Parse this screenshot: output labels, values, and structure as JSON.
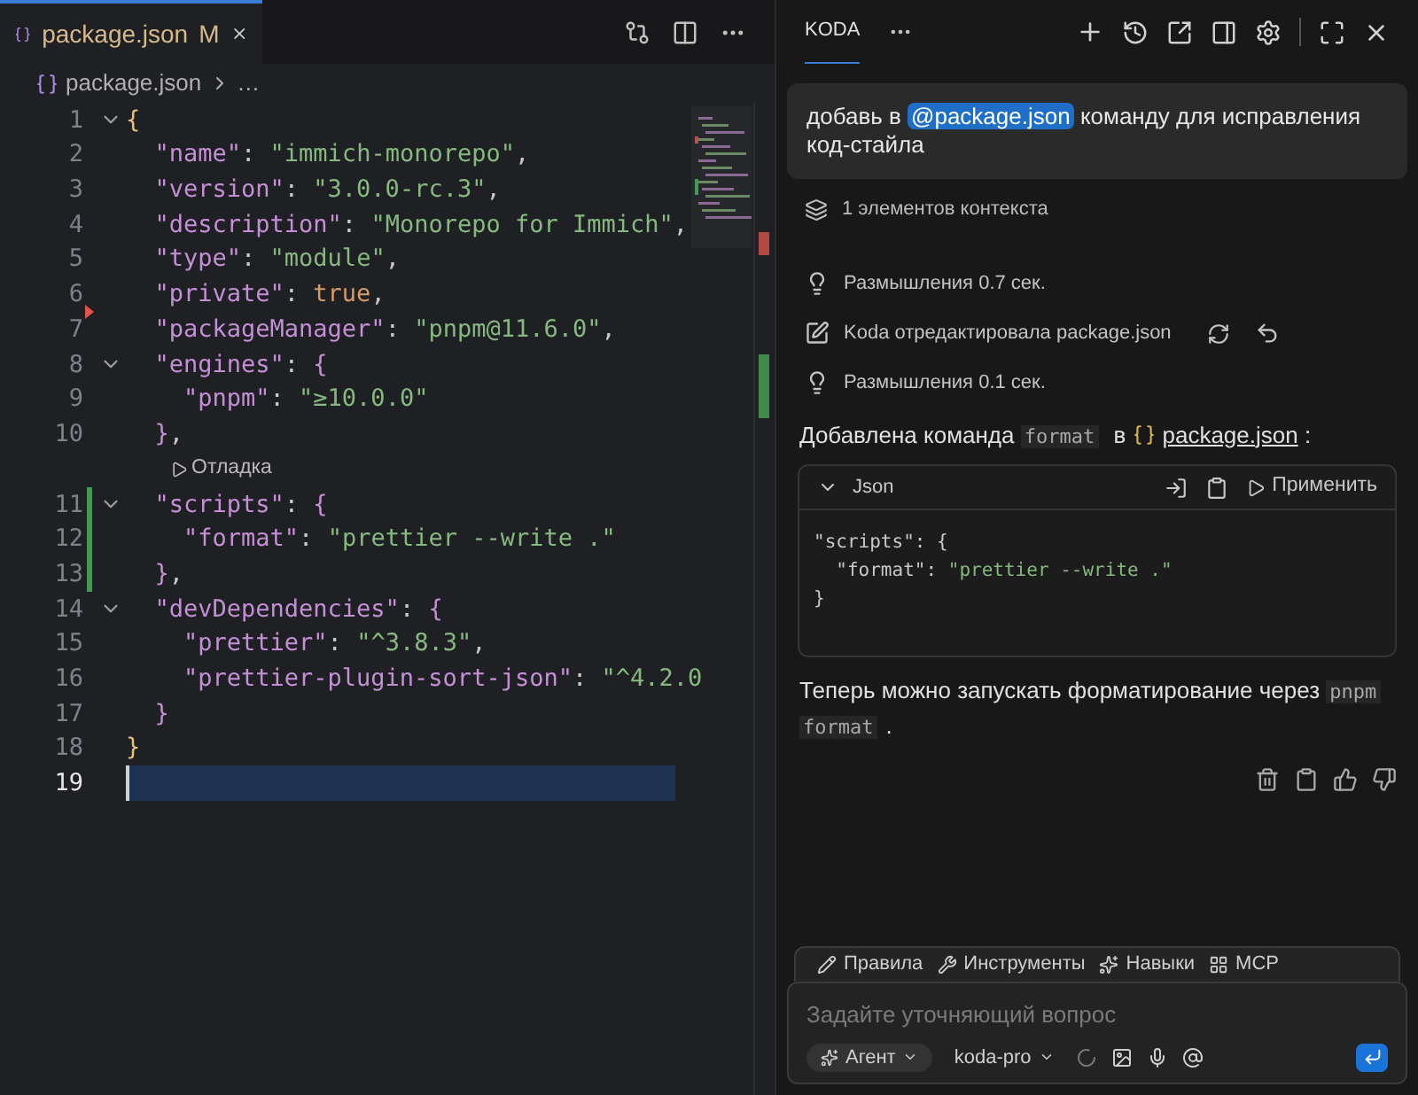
{
  "editor": {
    "tab": {
      "title": "package.json",
      "badge": "M"
    },
    "breadcrumb": {
      "file": "package.json",
      "rest": "…"
    },
    "lines": [
      {
        "kind": "code",
        "number": "1",
        "foldable": true,
        "selected": false,
        "tokens": [
          {
            "kind": "brace0",
            "text": "{"
          }
        ]
      },
      {
        "kind": "code",
        "number": "2",
        "selected": false,
        "tokens": [
          {
            "kind": "key",
            "text": "  \"name\""
          },
          {
            "kind": "punct",
            "text": ": "
          },
          {
            "kind": "str",
            "text": "\"immich-monorepo\""
          },
          {
            "kind": "punct",
            "text": ","
          }
        ]
      },
      {
        "kind": "code",
        "number": "3",
        "selected": false,
        "tokens": [
          {
            "kind": "key",
            "text": "  \"version\""
          },
          {
            "kind": "punct",
            "text": ": "
          },
          {
            "kind": "str",
            "text": "\"3.0.0-rc.3\""
          },
          {
            "kind": "punct",
            "text": ","
          }
        ]
      },
      {
        "kind": "code",
        "number": "4",
        "selected": false,
        "tokens": [
          {
            "kind": "key",
            "text": "  \"description\""
          },
          {
            "kind": "punct",
            "text": ": "
          },
          {
            "kind": "str",
            "text": "\"Monorepo for Immich\""
          },
          {
            "kind": "punct",
            "text": ","
          }
        ]
      },
      {
        "kind": "code",
        "number": "5",
        "selected": false,
        "tokens": [
          {
            "kind": "key",
            "text": "  \"type\""
          },
          {
            "kind": "punct",
            "text": ": "
          },
          {
            "kind": "str",
            "text": "\"module\""
          },
          {
            "kind": "punct",
            "text": ","
          }
        ]
      },
      {
        "kind": "code",
        "number": "6",
        "deleted": true,
        "selected": false,
        "tokens": [
          {
            "kind": "key",
            "text": "  \"private\""
          },
          {
            "kind": "punct",
            "text": ": "
          },
          {
            "kind": "bool",
            "text": "true"
          },
          {
            "kind": "punct",
            "text": ","
          }
        ]
      },
      {
        "kind": "code",
        "number": "7",
        "selected": false,
        "tokens": [
          {
            "kind": "key",
            "text": "  \"packageManager\""
          },
          {
            "kind": "punct",
            "text": ": "
          },
          {
            "kind": "str",
            "text": "\"pnpm@11.6.0\""
          },
          {
            "kind": "punct",
            "text": ","
          }
        ]
      },
      {
        "kind": "code",
        "number": "8",
        "foldable": true,
        "selected": false,
        "tokens": [
          {
            "kind": "key",
            "text": "  \"engines\""
          },
          {
            "kind": "punct",
            "text": ": "
          },
          {
            "kind": "brace1",
            "text": "{"
          }
        ]
      },
      {
        "kind": "code",
        "number": "9",
        "selected": false,
        "tokens": [
          {
            "kind": "key",
            "text": "    \"pnpm\""
          },
          {
            "kind": "punct",
            "text": ": "
          },
          {
            "kind": "str",
            "text": "\"≥10.0.0\""
          }
        ]
      },
      {
        "kind": "code",
        "number": "10",
        "selected": false,
        "tokens": [
          {
            "kind": "brace1",
            "text": "  }"
          },
          {
            "kind": "punct",
            "text": ","
          }
        ]
      },
      {
        "kind": "codelens",
        "text": "Отладка"
      },
      {
        "kind": "code",
        "number": "11",
        "foldable": true,
        "added": true,
        "selected": false,
        "tokens": [
          {
            "kind": "key",
            "text": "  \"scripts\""
          },
          {
            "kind": "punct",
            "text": ": "
          },
          {
            "kind": "brace1",
            "text": "{"
          }
        ]
      },
      {
        "kind": "code",
        "number": "12",
        "added": true,
        "selected": false,
        "tokens": [
          {
            "kind": "key",
            "text": "    \"format\""
          },
          {
            "kind": "punct",
            "text": ": "
          },
          {
            "kind": "str",
            "text": "\"prettier --write .\""
          }
        ]
      },
      {
        "kind": "code",
        "number": "13",
        "added": true,
        "selected": false,
        "tokens": [
          {
            "kind": "brace1",
            "text": "  }"
          },
          {
            "kind": "punct",
            "text": ","
          }
        ]
      },
      {
        "kind": "code",
        "number": "14",
        "foldable": true,
        "selected": false,
        "tokens": [
          {
            "kind": "key",
            "text": "  \"devDependencies\""
          },
          {
            "kind": "punct",
            "text": ": "
          },
          {
            "kind": "brace1",
            "text": "{"
          }
        ]
      },
      {
        "kind": "code",
        "number": "15",
        "selected": false,
        "tokens": [
          {
            "kind": "key",
            "text": "    \"prettier\""
          },
          {
            "kind": "punct",
            "text": ": "
          },
          {
            "kind": "str",
            "text": "\"^3.8.3\""
          },
          {
            "kind": "punct",
            "text": ","
          }
        ]
      },
      {
        "kind": "code",
        "number": "16",
        "selected": false,
        "tokens": [
          {
            "kind": "key",
            "text": "    \"prettier-plugin-sort-json\""
          },
          {
            "kind": "punct",
            "text": ": "
          },
          {
            "kind": "str",
            "text": "\"^4.2.0"
          }
        ]
      },
      {
        "kind": "code",
        "number": "17",
        "selected": false,
        "tokens": [
          {
            "kind": "brace1",
            "text": "  }"
          }
        ]
      },
      {
        "kind": "code",
        "number": "18",
        "selected": false,
        "tokens": [
          {
            "kind": "brace0",
            "text": "}"
          }
        ]
      },
      {
        "kind": "code",
        "number": "19",
        "selected": true
      }
    ]
  },
  "chat": {
    "header": {
      "title": "KODA"
    },
    "user_message": [
      {
        "kind": "text",
        "text": "добавь в "
      },
      {
        "kind": "mention",
        "text": "@package.json"
      },
      {
        "kind": "text",
        "text": " команду для исправления код-стайла"
      }
    ],
    "context": "1 элементов контекста",
    "steps": [
      {
        "kind": "thinking",
        "text": "Размышления 0.7 сек."
      },
      {
        "kind": "edit",
        "text": "Koda отредактировала package.json"
      },
      {
        "kind": "thinking",
        "text": "Размышления 0.1 сек."
      }
    ],
    "response": [
      {
        "kind": "text",
        "text": "Добавлена команда "
      },
      {
        "kind": "code",
        "text": "format"
      },
      {
        "kind": "text",
        "text": " в "
      },
      {
        "kind": "file",
        "text": "package.json"
      },
      {
        "kind": "text",
        "text": " :"
      }
    ],
    "code_block": {
      "language": "Json",
      "apply": "Применить",
      "lines": [
        [
          {
            "kind": "key",
            "text": "\"scripts\""
          },
          {
            "kind": "punct",
            "text": ": {"
          }
        ],
        [
          {
            "kind": "key",
            "text": "  \"format\""
          },
          {
            "kind": "punct",
            "text": ": "
          },
          {
            "kind": "str",
            "text": "\"prettier --write .\""
          }
        ],
        [
          {
            "kind": "punct",
            "text": "}"
          }
        ]
      ]
    },
    "footer": [
      {
        "kind": "text",
        "text": "Теперь можно запускать форматирование через "
      },
      {
        "kind": "code",
        "text": "pnpm"
      },
      {
        "kind": "code",
        "text": "format"
      },
      {
        "kind": "text",
        "text": "."
      }
    ],
    "tools": [
      {
        "kind": "rules",
        "label": "Правила"
      },
      {
        "kind": "tools",
        "label": "Инструменты"
      },
      {
        "kind": "skills",
        "label": "Навыки"
      },
      {
        "kind": "mcp",
        "label": "MCP"
      }
    ],
    "input": {
      "placeholder": "Задайте уточняющий вопрос",
      "mode": "Агент",
      "model": "koda-pro"
    }
  }
}
